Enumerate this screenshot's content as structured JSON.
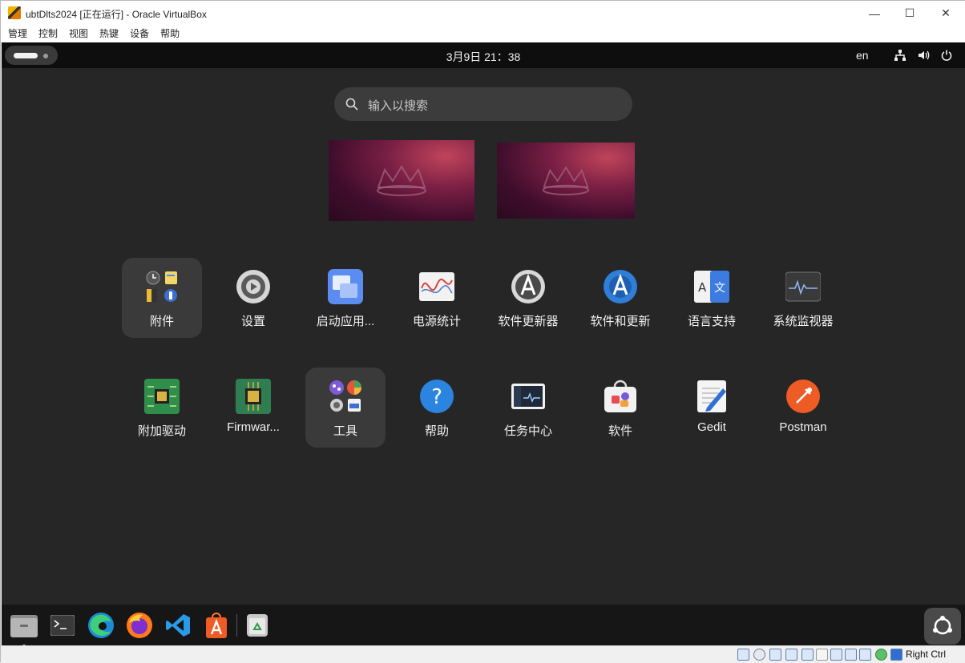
{
  "window": {
    "title": "ubtDlts2024 [正在运行] - Oracle VirtualBox",
    "minimize_glyph": "—",
    "maximize_glyph": "☐",
    "close_glyph": "✕"
  },
  "menu": [
    "管理",
    "控制",
    "视图",
    "热键",
    "设备",
    "帮助"
  ],
  "topbar": {
    "clock": "3月9日  21：38",
    "lang": "en"
  },
  "search": {
    "placeholder": "输入以搜索"
  },
  "apps_row1": [
    {
      "label": "附件",
      "icon": "accessories-folder-icon"
    },
    {
      "label": "设置",
      "icon": "settings-gear-icon"
    },
    {
      "label": "启动应用...",
      "icon": "startup-apps-icon"
    },
    {
      "label": "电源统计",
      "icon": "power-statistics-icon"
    },
    {
      "label": "软件更新器",
      "icon": "software-updater-icon"
    },
    {
      "label": "软件和更新",
      "icon": "software-updates-icon"
    },
    {
      "label": "语言支持",
      "icon": "language-support-icon"
    },
    {
      "label": "系统监视器",
      "icon": "system-monitor-icon"
    }
  ],
  "apps_row2": [
    {
      "label": "附加驱动",
      "icon": "additional-drivers-icon"
    },
    {
      "label": "Firmwar...",
      "icon": "firmware-chip-icon"
    },
    {
      "label": "工具",
      "icon": "utilities-folder-icon"
    },
    {
      "label": "帮助",
      "icon": "help-icon"
    },
    {
      "label": "任务中心",
      "icon": "mission-center-icon"
    },
    {
      "label": "软件",
      "icon": "app-center-icon"
    },
    {
      "label": "Gedit",
      "icon": "gedit-icon"
    },
    {
      "label": "Postman",
      "icon": "postman-icon"
    }
  ],
  "dock": [
    "files-icon",
    "terminal-icon",
    "edge-icon",
    "firefox-icon",
    "vscode-icon",
    "app-store-icon",
    "trash-icon"
  ],
  "statusbar": {
    "host_key": "Right Ctrl"
  }
}
